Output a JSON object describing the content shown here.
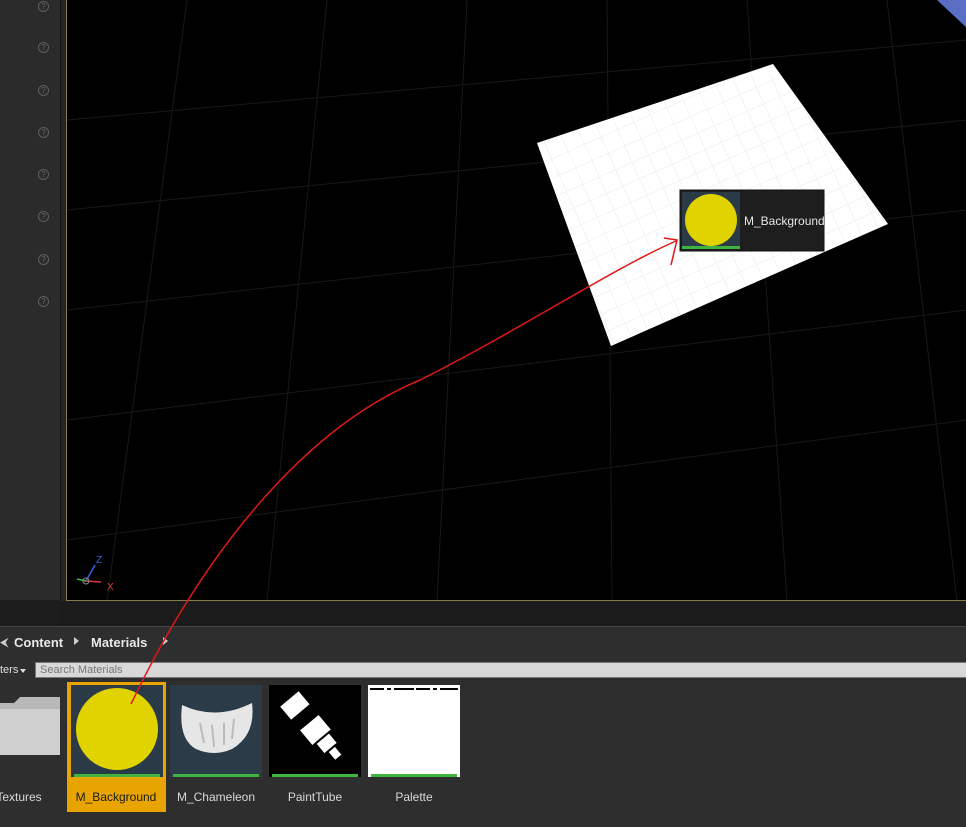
{
  "breadcrumb": {
    "root": "Content",
    "current": "Materials"
  },
  "filters": {
    "label": "ters",
    "search_placeholder": "Search Materials"
  },
  "assets": [
    {
      "name": "Textures",
      "type": "folder"
    },
    {
      "name": "M_Background",
      "type": "material",
      "selected": true
    },
    {
      "name": "M_Chameleon",
      "type": "material"
    },
    {
      "name": "PaintTube",
      "type": "texture"
    },
    {
      "name": "Palette",
      "type": "texture"
    }
  ],
  "drag_tooltip": {
    "label": "M_Background"
  },
  "axis_gizmo": {
    "z": "Z",
    "x": "X"
  },
  "colors": {
    "accent_selected": "#e8a400",
    "material_yellow": "#e0d300",
    "asset_bar": "#3fb53f",
    "drag_line": "#e01818"
  }
}
